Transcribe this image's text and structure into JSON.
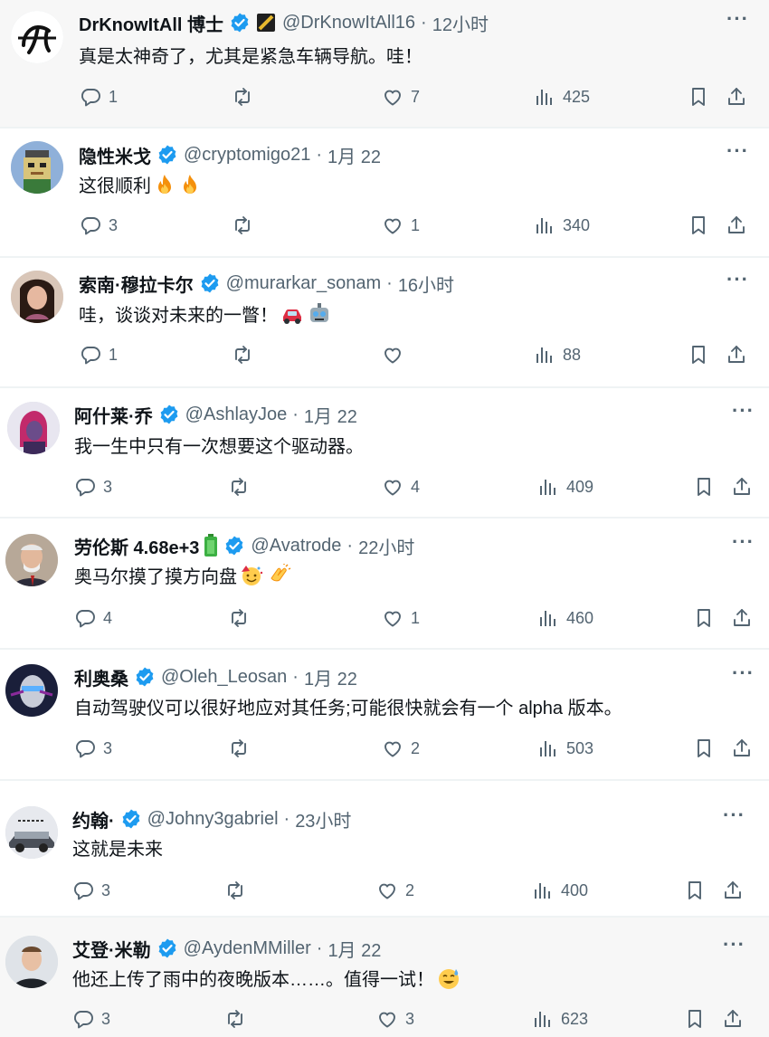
{
  "tweets": [
    {
      "name": "DrKnowItAll 博士",
      "handle": "@DrKnowItAll16",
      "time": "12小时",
      "text": "真是太神奇了，尤其是紧急车辆导航。哇！",
      "replies": "1",
      "retweets": "",
      "likes": "7",
      "views": "425",
      "extra": "flag-icon",
      "emoji": []
    },
    {
      "name": "隐性米戈",
      "handle": "@cryptomigo21",
      "time": "1月 22",
      "text": "这很顺利",
      "replies": "3",
      "retweets": "",
      "likes": "1",
      "views": "340",
      "extra": "",
      "emoji": [
        "fire-emoji",
        "fire-emoji"
      ]
    },
    {
      "name": "索南·穆拉卡尔",
      "handle": "@murarkar_sonam",
      "time": "16小时",
      "text": "哇，谈谈对未来的一瞥！",
      "replies": "1",
      "retweets": "",
      "likes": "",
      "views": "88",
      "extra": "",
      "emoji": [
        "car-emoji",
        "robot-emoji"
      ]
    },
    {
      "name": "阿什莱·乔",
      "handle": "@AshlayJoe",
      "time": "1月 22",
      "text": "我一生中只有一次想要这个驱动器。",
      "replies": "3",
      "retweets": "",
      "likes": "4",
      "views": "409",
      "extra": "",
      "emoji": []
    },
    {
      "name": "劳伦斯 4.68e+3",
      "handle": "@Avatrode",
      "time": "22小时",
      "text": "奥马尔摸了摸方向盘",
      "replies": "4",
      "retweets": "",
      "likes": "1",
      "views": "460",
      "extra": "battery-icon",
      "emoji": [
        "party-emoji",
        "clap-emoji"
      ]
    },
    {
      "name": "利奥桑",
      "handle": "@Oleh_Leosan",
      "time": "1月 22",
      "text": "自动驾驶仪可以很好地应对其任务;可能很快就会有一个 alpha 版本。",
      "replies": "3",
      "retweets": "",
      "likes": "2",
      "views": "503",
      "extra": "",
      "emoji": []
    },
    {
      "name": "约翰·",
      "handle": "@Johny3gabriel",
      "time": "23小时",
      "text": "这就是未来",
      "replies": "3",
      "retweets": "",
      "likes": "2",
      "views": "400",
      "extra": "",
      "emoji": []
    },
    {
      "name": "艾登·米勒",
      "handle": "@AydenMMiller",
      "time": "1月 22",
      "text": "他还上传了雨中的夜晚版本……。值得一试！",
      "replies": "3",
      "retweets": "",
      "likes": "3",
      "views": "623",
      "extra": "",
      "emoji": [
        "sweat-smile-emoji"
      ]
    }
  ],
  "colors": {
    "verified": "#1d9bf0",
    "muted": "#536471",
    "text": "#0f1419",
    "highlight": "#f7f7f7",
    "divider": "#eff3f4"
  },
  "icons": {
    "reply": "reply-icon",
    "retweet": "retweet-icon",
    "like": "like-icon",
    "views": "views-icon",
    "bookmark": "bookmark-icon",
    "share": "share-icon",
    "more": "more-icon",
    "verified": "verified-badge-icon"
  }
}
